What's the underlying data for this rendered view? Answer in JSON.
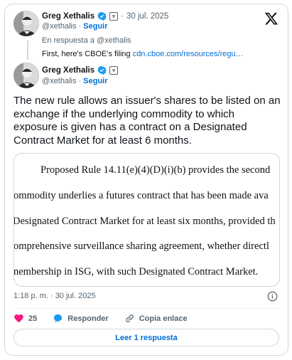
{
  "parent_tweet": {
    "author_name": "Greg Xethalis",
    "date": "30 jul. 2025",
    "date_sep": "·",
    "handle": "@xethalis",
    "follow_label": "Seguir",
    "reply_to": "En respuesta a @xethalis",
    "text_prefix": "First, here's CBOE's filing ",
    "link_text": "cdn.cboe.com/resources/regu…"
  },
  "main_tweet": {
    "author_name": "Greg Xethalis",
    "handle": "@xethalis",
    "follow_label": "Seguir",
    "text": "The new rule allows an issuer's shares to be listed on an exchange if the underlying commodity to which exposure is given has a contract on a Designated Contract Market for at least 6 months.",
    "media_lines": [
      "Proposed Rule 14.11(e)(4)(D)(i)(b) provides the second",
      "ommodity underlies a futures contract that has been made ava",
      "Designated Contract Market for at least six months, provided th",
      "omprehensive surveillance sharing agreement, whether directl",
      "nembership in ISG, with such Designated Contract Market."
    ],
    "time": "1:18 p. m. · 30 jul. 2025"
  },
  "actions": {
    "like_count": "25",
    "reply_label": "Responder",
    "copy_label": "Copia enlace"
  },
  "read_reply_label": "Leer 1 respuesta",
  "colors": {
    "accent": "#006fd6",
    "like": "#f91880",
    "reply": "#1d9bf0",
    "verified": "#1d9bf0",
    "muted": "#536471"
  }
}
